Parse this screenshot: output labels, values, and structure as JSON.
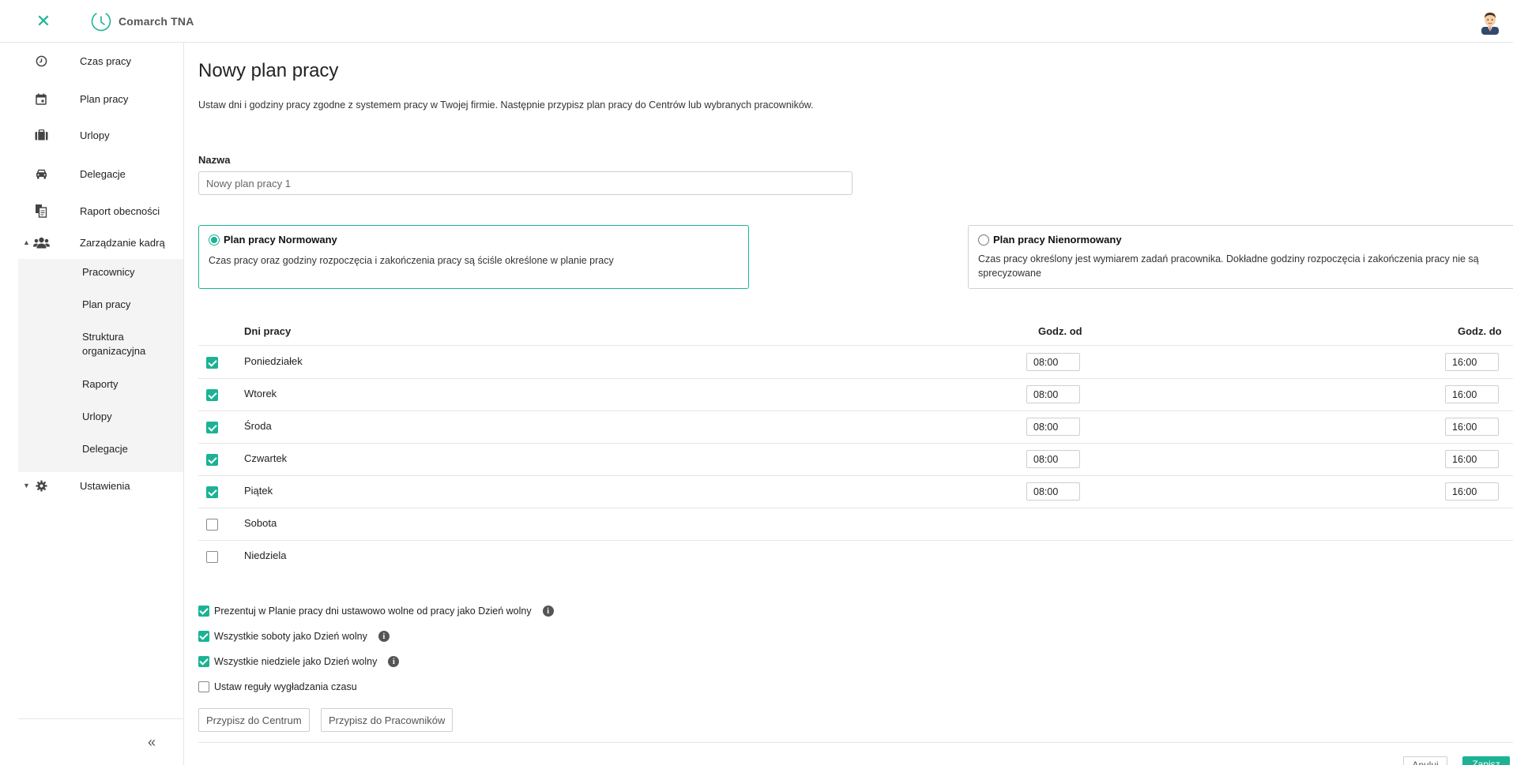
{
  "app": {
    "name": "Comarch TNA"
  },
  "sidebar": {
    "items": [
      {
        "label": "Czas pracy",
        "icon": "clock-icon"
      },
      {
        "label": "Plan pracy",
        "icon": "calendar-icon"
      },
      {
        "label": "Urlopy",
        "icon": "suitcase-icon"
      },
      {
        "label": "Delegacje",
        "icon": "car-icon"
      },
      {
        "label": "Raport obecności",
        "icon": "documents-icon"
      },
      {
        "label": "Zarządzanie kadrą",
        "icon": "users-icon",
        "expanded": true
      },
      {
        "label": "Ustawienia",
        "icon": "gear-icon",
        "expanded": false
      }
    ],
    "subitems": [
      {
        "label": "Pracownicy"
      },
      {
        "label": "Plan pracy"
      },
      {
        "label": "Struktura organizacyjna"
      },
      {
        "label": "Raporty"
      },
      {
        "label": "Urlopy"
      },
      {
        "label": "Delegacje"
      }
    ],
    "collapse_glyph": "«"
  },
  "page": {
    "title": "Nowy plan pracy",
    "description": "Ustaw dni i godziny pracy zgodne z systemem pracy w Twojej firmie. Następnie przypisz plan pracy do Centrów lub wybranych pracowników."
  },
  "form": {
    "name_label": "Nazwa",
    "name_value": "Nowy plan pracy 1"
  },
  "plan_types": [
    {
      "title": "Plan pracy Normowany",
      "description": "Czas pracy oraz godziny rozpoczęcia i zakończenia pracy są ściśle określone w planie pracy",
      "selected": true
    },
    {
      "title": "Plan pracy Nienormowany",
      "description": "Czas pracy określony jest wymiarem zadań pracownika. Dokładne godziny rozpoczęcia i zakończenia pracy nie są sprecyzowane",
      "selected": false
    }
  ],
  "days_table": {
    "headers": {
      "days": "Dni pracy",
      "from": "Godz. od",
      "to": "Godz. do"
    },
    "rows": [
      {
        "day": "Poniedziałek",
        "checked": true,
        "from": "08:00",
        "to": "16:00"
      },
      {
        "day": "Wtorek",
        "checked": true,
        "from": "08:00",
        "to": "16:00"
      },
      {
        "day": "Środa",
        "checked": true,
        "from": "08:00",
        "to": "16:00"
      },
      {
        "day": "Czwartek",
        "checked": true,
        "from": "08:00",
        "to": "16:00"
      },
      {
        "day": "Piątek",
        "checked": true,
        "from": "08:00",
        "to": "16:00"
      },
      {
        "day": "Sobota",
        "checked": false
      },
      {
        "day": "Niedziela",
        "checked": false
      }
    ]
  },
  "options": [
    {
      "label": "Prezentuj w Planie pracy dni ustawowo wolne od pracy jako Dzień wolny",
      "checked": true,
      "info": true
    },
    {
      "label": "Wszystkie soboty jako Dzień wolny",
      "checked": true,
      "info": true
    },
    {
      "label": "Wszystkie niedziele jako Dzień wolny",
      "checked": true,
      "info": true
    },
    {
      "label": "Ustaw reguły wygładzania czasu",
      "checked": false,
      "info": false
    }
  ],
  "buttons": {
    "assign_center": "Przypisz do Centrum",
    "assign_employees": "Przypisz do Pracowników",
    "cancel": "Anuluj",
    "save": "Zapisz"
  },
  "colors": {
    "accent": "#1bb394",
    "border": "#e6e6e6"
  }
}
